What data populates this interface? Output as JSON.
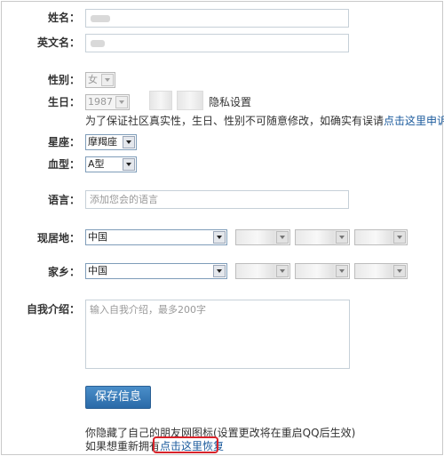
{
  "form": {
    "name_label": "姓名：",
    "english_name_label": "英文名：",
    "gender_label": "性别：",
    "gender_value": "女",
    "birthday_label": "生日：",
    "birthday_year": "1987",
    "privacy_link": "隐私设置",
    "birthday_note_prefix": "为了保证社区真实性，生日、性别不可随意修改，如确实有误请",
    "birthday_note_link": "点击这里申诉",
    "birthday_note_suffix": "。",
    "zodiac_label": "星座：",
    "zodiac_value": "摩羯座",
    "blood_label": "血型：",
    "blood_value": "A型",
    "language_label": "语言：",
    "language_placeholder": "添加您会的语言",
    "residence_label": "现居地：",
    "residence_country": "中国",
    "hometown_label": "家乡：",
    "hometown_country": "中国",
    "intro_label": "自我介绍：",
    "intro_placeholder": "输入自我介绍，最多200字",
    "save_label": "保存信息"
  },
  "footer": {
    "hidden_icon_note": "你隐藏了自己的朋友网图标(设置更改将在重启QQ后生效)",
    "restore_prefix": "如果想重新拥有",
    "restore_link": "点击这里恢复"
  },
  "colors": {
    "link": "#1a5a9c",
    "save_button": "#3b7cbb",
    "highlight": "#d8232a"
  }
}
